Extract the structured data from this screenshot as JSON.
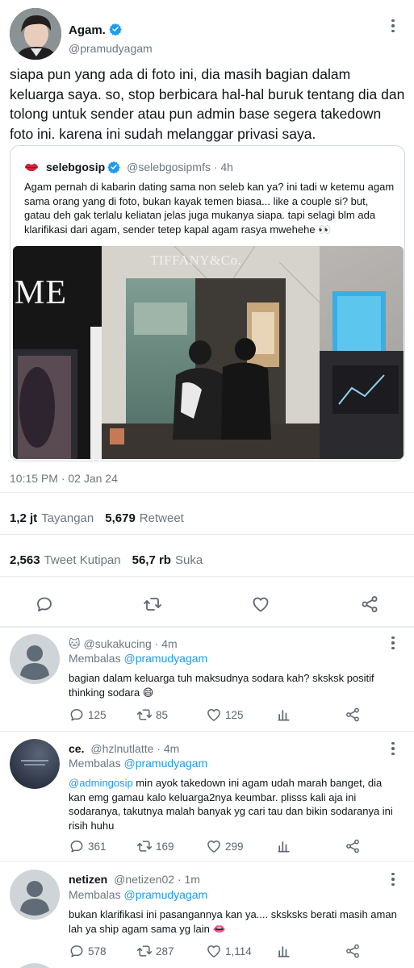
{
  "colors": {
    "accent": "#1d9bf0",
    "secondary_text": "#6b7780",
    "divider": "#e6ecf0"
  },
  "main_tweet": {
    "author_name": "Agam.",
    "author_handle": "@pramudyagam",
    "verified": true,
    "text": "siapa pun yang ada di foto ini, dia masih bagian dalam keluarga saya. so, stop berbicara hal-hal buruk tentang dia dan tolong untuk sender atau pun admin base segera takedown foto ini. karena ini sudah melanggar privasi saya.",
    "timestamp": "10:15 PM · 02 Jan 24",
    "stats": {
      "views_count": "1,2 jt",
      "views_label": "Tayangan",
      "retweets_count": "5,679",
      "retweets_label": "Retweet",
      "quotes_count": "2,563",
      "quotes_label": "Tweet Kutipan",
      "likes_count": "56,7 rb",
      "likes_label": "Suka"
    },
    "actions": [
      "reply-icon",
      "retweet-icon",
      "like-icon",
      "share-icon"
    ]
  },
  "quoted_tweet": {
    "author_name": "selebgosip",
    "author_handle": "@selebgosipmfs",
    "time": "· 4h",
    "verified": true,
    "text": "Agam pernah di kabarin dating sama non seleb kan ya? ini tadi w ketemu agam sama orang yang di foto, bukan kayak temen biasa... like a couple si? but, gatau deh gak terlalu keliatan jelas juga mukanya siapa. tapi selagi blm ada klarifikasi dari agam, sender tetep kapal agam rasya mwehehe 👀",
    "photo": {
      "store_sign_left": "ME",
      "store_sign_center": "TIFFANY&Co."
    }
  },
  "replies": [
    {
      "emoji": "🐱",
      "name": "",
      "handle": "@sukakucing",
      "time": "· 4m",
      "replying_label": "Membalas",
      "replying_to": "@pramudyagam",
      "mention": "",
      "text": "bagian dalam keluarga tuh maksudnya sodara kah? sksksk positif thinking sodara 😄",
      "replies": "125",
      "retweets": "85",
      "likes": "125"
    },
    {
      "emoji": "",
      "name": "ce.",
      "handle": "@hzlnutlatte",
      "time": "· 4m",
      "replying_label": "Membalas",
      "replying_to": "@pramudyagam",
      "mention": "@admingosip",
      "text": " min ayok takedown ini agam udah marah banget, dia kan emg gamau kalo keluarga2nya keumbar. plisss kali aja ini sodaranya, takutnya malah banyak yg cari tau dan bikin sodaranya ini risih huhu",
      "replies": "361",
      "retweets": "169",
      "likes": "299"
    },
    {
      "emoji": "",
      "name": "netizen",
      "handle": "@netizen02",
      "time": "· 1m",
      "replying_label": "Membalas",
      "replying_to": "@pramudyagam",
      "mention": "",
      "text": "bukan klarifikasi ini pasangannya kan ya.... sksksks berati masih aman lah ya ship agam sama yg lain 👄",
      "replies": "578",
      "retweets": "287",
      "likes": "1,114"
    }
  ]
}
